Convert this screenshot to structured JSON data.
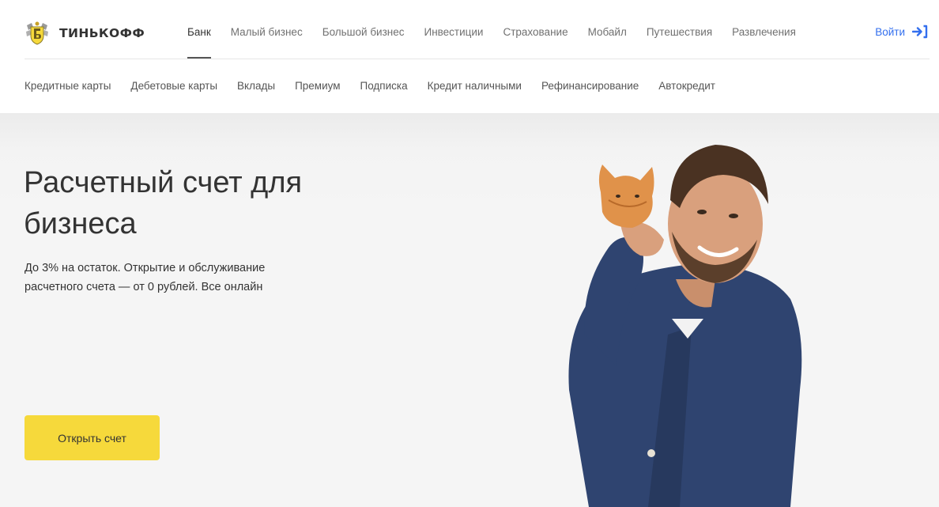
{
  "brand": {
    "logo_text": "ТИНЬКОФФ",
    "logo_icon": "coat-of-arms-icon"
  },
  "main_nav": [
    {
      "label": "Банк",
      "active": true
    },
    {
      "label": "Малый бизнес",
      "active": false
    },
    {
      "label": "Большой бизнес",
      "active": false
    },
    {
      "label": "Инвестиции",
      "active": false
    },
    {
      "label": "Страхование",
      "active": false
    },
    {
      "label": "Мобайл",
      "active": false
    },
    {
      "label": "Путешествия",
      "active": false
    },
    {
      "label": "Развлечения",
      "active": false
    }
  ],
  "login": {
    "label": "Войти",
    "icon": "login-arrow-icon"
  },
  "sub_nav": [
    "Кредитные карты",
    "Дебетовые карты",
    "Вклады",
    "Премиум",
    "Подписка",
    "Кредит наличными",
    "Рефинансирование",
    "Автокредит"
  ],
  "hero": {
    "title": "Расчетный счет для бизнеса",
    "subtitle": "До 3% на остаток. Открытие и обслуживание расчетного счета — от 0 рублей. Все онлайн",
    "button_label": "Открыть счет"
  },
  "colors": {
    "accent_yellow": "#f6d93b",
    "link_blue": "#336fee",
    "hero_background": "#f5f5f5",
    "text_dark": "#333333"
  }
}
